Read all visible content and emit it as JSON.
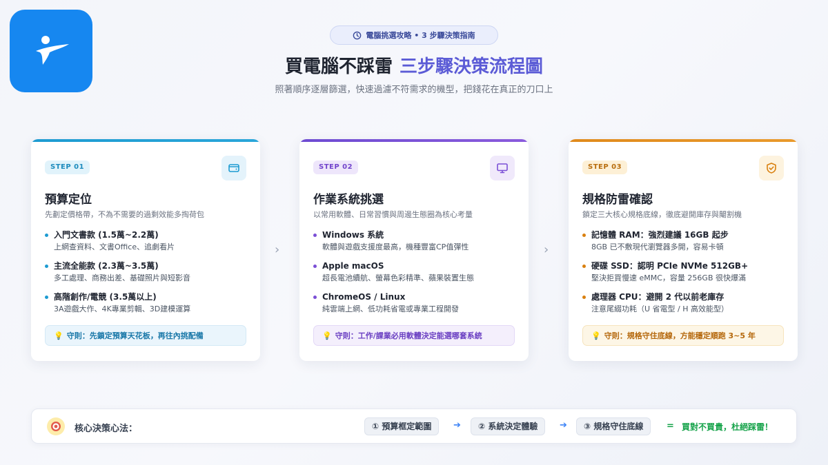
{
  "header": {
    "badge": "電腦挑選攻略 • 3 步驟決策指南",
    "title_main": "買電腦不踩雷",
    "title_highlight": "三步驟決策流程圖",
    "subtitle": "照著順序逐層篩選，快速過濾不符需求的機型，把錢花在真正的刀口上"
  },
  "colors": {
    "step1": "#1d9bd1",
    "step2": "#7b4fd6",
    "step3": "#e08a1c",
    "logo": "#1687f0",
    "title_highlight": "#5b5bd6"
  },
  "cards": [
    {
      "step": "STEP 01",
      "icon": "wallet-icon",
      "title": "預算定位",
      "desc": "先劃定價格帶，不為不需要的過剩效能多掏荷包",
      "items": [
        {
          "title": "入門文書款 (1.5萬~2.2萬)",
          "sub": "上網查資料、文書Office、追劇看片"
        },
        {
          "title": "主流全能款 (2.3萬~3.5萬)",
          "sub": "多工處理、商務出差、基礎照片與短影音"
        },
        {
          "title": "高階創作/電競 (3.5萬以上)",
          "sub": "3A遊戲大作、4K專業剪輯、3D建模運算"
        }
      ],
      "rule": "守則：先鎖定預算天花板，再往內挑配備"
    },
    {
      "step": "STEP 02",
      "icon": "monitor-icon",
      "title": "作業系統挑選",
      "desc": "以常用軟體、日常習慣與周邊生態圈為核心考量",
      "items": [
        {
          "title": "Windows 系統",
          "sub": "軟體與遊戲支援度最高，機種豐富CP值彈性"
        },
        {
          "title": "Apple macOS",
          "sub": "超長電池續航、螢幕色彩精準、蘋果裝置生態"
        },
        {
          "title": "ChromeOS / Linux",
          "sub": "純雲端上網、低功耗省電或專業工程開發"
        }
      ],
      "rule": "守則：工作/課業必用軟體決定能選哪套系統"
    },
    {
      "step": "STEP 03",
      "icon": "shield-check-icon",
      "title": "規格防雷確認",
      "desc": "鎖定三大核心規格底線，徹底避開庫存與閹割機",
      "items": [
        {
          "title": "記憶體 RAM：強烈建議 16GB 起步",
          "sub": "8GB 已不敷現代瀏覽器多開，容易卡頓"
        },
        {
          "title": "硬碟 SSD：認明 PCIe NVMe 512GB+",
          "sub": "堅決拒買慢速 eMMC，容量 256GB 很快爆滿"
        },
        {
          "title": "處理器 CPU：避開 2 代以前老庫存",
          "sub": "注意尾綴功耗（U 省電型 / H 高效能型）"
        }
      ],
      "rule": "守則：規格守住底線，方能穩定順跑 3~5 年"
    }
  ],
  "footer": {
    "label": "核心決策心法：",
    "chips": [
      "① 預算框定範圍",
      "② 系統決定體驗",
      "③ 規格守住底線"
    ],
    "equals": "=",
    "slogan": "買對不買貴，杜絕踩雷！"
  }
}
